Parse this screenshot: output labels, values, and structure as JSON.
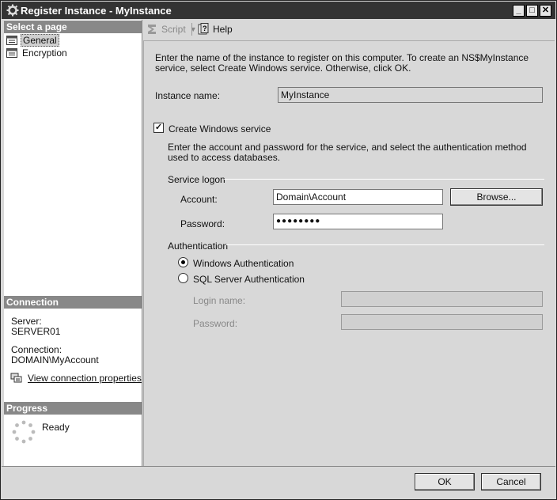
{
  "window": {
    "title": "Register Instance - MyInstance",
    "minimize_glyph": "_",
    "maximize_glyph": "□",
    "close_glyph": "✕"
  },
  "left": {
    "select_page_header": "Select a page",
    "pages": [
      {
        "label": "General",
        "selected": true,
        "icon": "page-properties-icon"
      },
      {
        "label": "Encryption",
        "selected": false,
        "icon": "page-properties-icon"
      }
    ],
    "connection_header": "Connection",
    "server_label": "Server:",
    "server_value": "SERVER01",
    "connection_label": "Connection:",
    "connection_value": "DOMAIN\\MyAccount",
    "view_props_link": "View connection properties",
    "progress_header": "Progress",
    "progress_status": "Ready"
  },
  "toolbar": {
    "script_label": "Script",
    "help_label": "Help"
  },
  "general": {
    "intro": "Enter the name of the instance to register on this computer. To create an NS$MyInstance service, select Create Windows service. Otherwise, click OK.",
    "instance_name_label": "Instance name:",
    "instance_name_value": "MyInstance",
    "create_service_label": "Create Windows service",
    "create_service_checked": true,
    "service_desc": "Enter the account and password for the service, and select the authentication method used to access databases.",
    "service_logon_label": "Service logon",
    "account_label": "Account:",
    "account_value": "Domain\\Account",
    "browse_label": "Browse...",
    "password_label": "Password:",
    "password_value": "●●●●●●●●",
    "authentication_label": "Authentication",
    "windows_auth_label": "Windows Authentication",
    "sql_auth_label": "SQL Server Authentication",
    "selected_auth": "windows",
    "login_name_label": "Login name:",
    "login_name_value": "",
    "sql_password_label": "Password:",
    "sql_password_value": ""
  },
  "buttons": {
    "ok_label": "OK",
    "cancel_label": "Cancel"
  }
}
